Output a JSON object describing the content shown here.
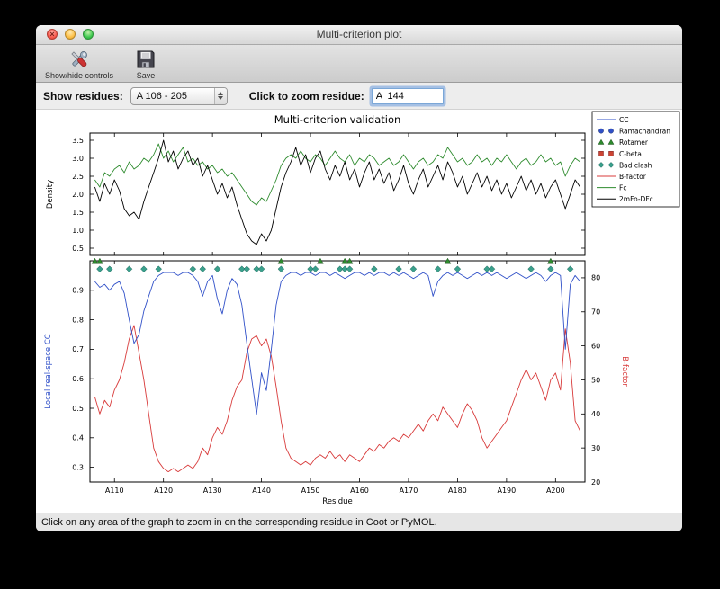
{
  "window": {
    "title": "Multi-criterion plot",
    "toolbar": {
      "buttons": [
        {
          "label": "Show/hide controls",
          "icon": "tools-icon"
        },
        {
          "label": "Save",
          "icon": "save-icon"
        }
      ]
    },
    "controls": {
      "show_residues_label": "Show residues:",
      "residue_range_value": "A 106 - 205",
      "zoom_label": "Click to zoom residue:",
      "zoom_value": "A  144"
    },
    "status": "Click on any area of the graph to zoom in on the corresponding residue in Coot or PyMOL."
  },
  "chart_data": {
    "type": "line",
    "title": "Multi-criterion validation",
    "xlabel": "Residue",
    "xlim": [
      105,
      206
    ],
    "residue_start": 106,
    "x_ticks": [
      "A110",
      "A120",
      "A130",
      "A140",
      "A150",
      "A160",
      "A170",
      "A180",
      "A190",
      "A200"
    ],
    "x_tick_values": [
      110,
      120,
      130,
      140,
      150,
      160,
      170,
      180,
      190,
      200
    ],
    "top": {
      "ylabel": "Density",
      "ylim": [
        0.3,
        3.7
      ],
      "yticks": [
        0.5,
        1.0,
        1.5,
        2.0,
        2.5,
        3.0,
        3.5
      ],
      "series": [
        {
          "name": "Fc",
          "color": "#2e8b2e",
          "values": [
            2.4,
            2.2,
            2.6,
            2.5,
            2.7,
            2.8,
            2.6,
            2.9,
            2.7,
            2.8,
            3.0,
            2.9,
            3.1,
            3.4,
            3.0,
            3.2,
            2.9,
            3.1,
            3.3,
            2.9,
            3.0,
            2.8,
            2.9,
            2.7,
            2.8,
            2.6,
            2.7,
            2.5,
            2.6,
            2.4,
            2.2,
            2.0,
            1.8,
            1.7,
            1.9,
            1.8,
            2.1,
            2.4,
            2.8,
            3.0,
            3.1,
            3.0,
            3.2,
            3.0,
            2.9,
            3.1,
            3.0,
            2.8,
            3.0,
            3.2,
            3.0,
            2.9,
            3.1,
            2.8,
            3.0,
            2.9,
            3.1,
            3.0,
            2.8,
            2.9,
            3.0,
            2.8,
            2.9,
            3.1,
            2.9,
            2.7,
            2.9,
            3.0,
            2.8,
            2.9,
            3.1,
            3.0,
            3.3,
            3.1,
            2.9,
            3.0,
            2.8,
            2.9,
            3.1,
            2.9,
            3.0,
            2.8,
            3.0,
            2.9,
            3.1,
            2.9,
            2.7,
            2.9,
            3.0,
            2.8,
            2.9,
            3.1,
            2.9,
            3.0,
            2.8,
            2.9,
            2.5,
            2.8,
            3.0,
            2.9
          ]
        },
        {
          "name": "2mFo-DFc",
          "color": "#000000",
          "values": [
            2.2,
            1.8,
            2.3,
            2.0,
            2.4,
            2.1,
            1.6,
            1.4,
            1.5,
            1.3,
            1.8,
            2.2,
            2.6,
            3.0,
            3.5,
            2.9,
            3.2,
            2.7,
            3.0,
            3.2,
            2.8,
            3.0,
            2.5,
            2.8,
            2.4,
            2.0,
            2.3,
            1.9,
            2.2,
            1.7,
            1.3,
            0.9,
            0.7,
            0.6,
            0.9,
            0.7,
            1.0,
            1.6,
            2.2,
            2.6,
            2.9,
            3.3,
            2.8,
            3.1,
            2.6,
            3.0,
            3.2,
            2.7,
            2.4,
            2.8,
            2.5,
            2.9,
            2.4,
            2.7,
            2.2,
            2.6,
            2.9,
            2.4,
            2.7,
            2.3,
            2.6,
            2.1,
            2.4,
            2.8,
            2.3,
            2.0,
            2.4,
            2.7,
            2.2,
            2.5,
            2.8,
            2.4,
            2.9,
            2.6,
            2.2,
            2.5,
            2.0,
            2.3,
            2.6,
            2.2,
            2.5,
            2.1,
            2.4,
            2.0,
            2.3,
            1.9,
            2.2,
            2.5,
            2.1,
            2.4,
            2.0,
            2.3,
            1.9,
            2.2,
            2.4,
            2.0,
            1.6,
            2.0,
            2.4,
            2.2
          ]
        }
      ]
    },
    "bottom": {
      "left_ylabel": "Local real-space CC",
      "left_ylabel_color": "#3050c8",
      "left_ylim": [
        0.25,
        1.0
      ],
      "left_yticks": [
        0.3,
        0.4,
        0.5,
        0.6,
        0.7,
        0.8,
        0.9
      ],
      "right_ylabel": "B-factor",
      "right_ylabel_color": "#d83b3b",
      "right_ylim": [
        20,
        85
      ],
      "right_yticks": [
        20,
        30,
        40,
        50,
        60,
        70,
        80
      ],
      "cc": {
        "name": "CC",
        "color": "#3050c8",
        "values": [
          0.93,
          0.91,
          0.92,
          0.9,
          0.92,
          0.93,
          0.89,
          0.8,
          0.72,
          0.75,
          0.83,
          0.88,
          0.93,
          0.95,
          0.96,
          0.96,
          0.96,
          0.95,
          0.96,
          0.96,
          0.95,
          0.93,
          0.88,
          0.93,
          0.95,
          0.87,
          0.82,
          0.9,
          0.94,
          0.92,
          0.85,
          0.72,
          0.6,
          0.48,
          0.62,
          0.56,
          0.7,
          0.85,
          0.93,
          0.95,
          0.96,
          0.96,
          0.95,
          0.96,
          0.96,
          0.95,
          0.96,
          0.96,
          0.95,
          0.96,
          0.95,
          0.94,
          0.95,
          0.96,
          0.96,
          0.95,
          0.96,
          0.95,
          0.96,
          0.96,
          0.95,
          0.96,
          0.95,
          0.96,
          0.95,
          0.94,
          0.95,
          0.96,
          0.95,
          0.88,
          0.93,
          0.95,
          0.96,
          0.95,
          0.96,
          0.95,
          0.94,
          0.95,
          0.96,
          0.95,
          0.96,
          0.95,
          0.96,
          0.95,
          0.94,
          0.95,
          0.96,
          0.95,
          0.94,
          0.95,
          0.96,
          0.95,
          0.93,
          0.95,
          0.96,
          0.95,
          0.7,
          0.92,
          0.95,
          0.93
        ]
      },
      "bfactor": {
        "name": "B-factor",
        "color": "#d83b3b",
        "values": [
          45,
          40,
          44,
          42,
          47,
          50,
          55,
          62,
          66,
          58,
          50,
          40,
          30,
          26,
          24,
          23,
          24,
          23,
          24,
          25,
          24,
          26,
          30,
          28,
          33,
          36,
          34,
          38,
          44,
          48,
          50,
          58,
          62,
          63,
          60,
          62,
          57,
          48,
          38,
          30,
          27,
          26,
          25,
          26,
          25,
          27,
          28,
          27,
          29,
          27,
          28,
          26,
          28,
          27,
          26,
          28,
          30,
          29,
          31,
          30,
          32,
          33,
          32,
          34,
          33,
          35,
          37,
          35,
          38,
          40,
          38,
          42,
          40,
          38,
          36,
          40,
          43,
          41,
          38,
          33,
          30,
          32,
          34,
          36,
          38,
          42,
          46,
          50,
          53,
          50,
          52,
          48,
          44,
          50,
          52,
          47,
          65,
          55,
          38,
          35
        ]
      },
      "markers": [
        {
          "name": "Rotamer",
          "shape": "triangle",
          "color": "#2e8b2e",
          "y": 0.998,
          "residues": [
            106,
            107,
            144,
            152,
            157,
            158,
            178,
            199
          ]
        },
        {
          "name": "Bad clash",
          "shape": "diamond",
          "color": "#3aa08c",
          "y": 0.972,
          "residues": [
            107,
            109,
            113,
            116,
            119,
            126,
            128,
            131,
            136,
            137,
            139,
            140,
            144,
            150,
            151,
            156,
            157,
            158,
            163,
            168,
            171,
            176,
            180,
            186,
            187,
            195,
            199,
            203
          ]
        }
      ]
    },
    "legend": [
      {
        "label": "CC",
        "type": "line",
        "color": "#3050c8"
      },
      {
        "label": "Ramachandran",
        "type": "marker",
        "shape": "circle",
        "color": "#3050c8"
      },
      {
        "label": "Rotamer",
        "type": "marker",
        "shape": "triangle",
        "color": "#2e8b2e"
      },
      {
        "label": "C-beta",
        "type": "marker",
        "shape": "square",
        "color": "#cc4433"
      },
      {
        "label": "Bad clash",
        "type": "marker",
        "shape": "diamond",
        "color": "#3aa08c"
      },
      {
        "label": "B-factor",
        "type": "line",
        "color": "#d83b3b"
      },
      {
        "label": "Fc",
        "type": "line",
        "color": "#2e8b2e"
      },
      {
        "label": "2mFo-DFc",
        "type": "line",
        "color": "#000000"
      }
    ]
  }
}
